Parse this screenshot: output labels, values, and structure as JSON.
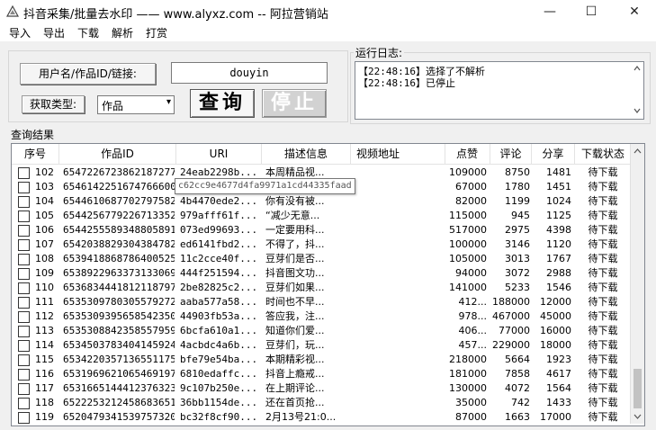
{
  "window": {
    "title": "抖音采集/批量去水印 —— www.alyxz.com -- 阿拉营销站",
    "minimize": "—",
    "maximize": "☐",
    "close": "✕"
  },
  "menu": [
    "导入",
    "导出",
    "下载",
    "解析",
    "打赏"
  ],
  "form": {
    "user_label": "用户名/作品ID/链接:",
    "user_value": "douyin",
    "type_label": "获取类型:",
    "type_value": "作品",
    "query_button": "查询",
    "stop_button": "停止"
  },
  "log": {
    "label": "运行日志:",
    "lines": [
      "【22:48:16】选择了不解析",
      "【22:48:16】已停止"
    ]
  },
  "results": {
    "label": "查询结果",
    "columns": [
      "序号",
      "作品ID",
      "URI",
      "描述信息",
      "视频地址",
      "点赞",
      "评论",
      "分享",
      "下载状态"
    ],
    "rows": [
      [
        "102",
        "6547226723862187277",
        "24eab2298b...",
        "本周精品视...",
        "",
        "109000",
        "8750",
        "1481",
        "待下载"
      ],
      [
        "103",
        "6546142251674766600",
        "",
        "",
        "",
        "67000",
        "1780",
        "1451",
        "待下载"
      ],
      [
        "104",
        "6544610687702797582",
        "4b4470ede2...",
        "你有没有被...",
        "",
        "82000",
        "1199",
        "1024",
        "待下载"
      ],
      [
        "105",
        "6544256779226713352",
        "979afff61f...",
        "“减少无意...",
        "",
        "115000",
        "945",
        "1125",
        "待下载"
      ],
      [
        "106",
        "6544255589348805891",
        "073ed99693...",
        "一定要用科...",
        "",
        "517000",
        "2975",
        "4398",
        "待下载"
      ],
      [
        "107",
        "6542038829304384782",
        "ed6141fbd2...",
        "不得了，抖...",
        "",
        "100000",
        "3146",
        "1120",
        "待下载"
      ],
      [
        "108",
        "6539418868786400525",
        "11c2cce40f...",
        "豆芽们是否...",
        "",
        "105000",
        "3013",
        "1767",
        "待下载"
      ],
      [
        "109",
        "6538922963373133069",
        "444f251594...",
        "抖音图文功...",
        "",
        "94000",
        "3072",
        "2988",
        "待下载"
      ],
      [
        "110",
        "6536834441812118797",
        "2be82825c2...",
        "豆芽们如果...",
        "",
        "141000",
        "5233",
        "1546",
        "待下载"
      ],
      [
        "111",
        "6535309780305579272",
        "aaba577a58...",
        "时间也不早...",
        "",
        "412...",
        "188000",
        "12000",
        "待下载"
      ],
      [
        "112",
        "6535309395658542350",
        "44903fb53a...",
        "答应我，注...",
        "",
        "978...",
        "467000",
        "45000",
        "待下载"
      ],
      [
        "113",
        "6535308842358557959",
        "6bcfa610a1...",
        "知道你们爱...",
        "",
        "406...",
        "77000",
        "16000",
        "待下载"
      ],
      [
        "114",
        "6534503783404145924",
        "4acbdc4a6b...",
        "豆芽们，玩...",
        "",
        "457...",
        "229000",
        "18000",
        "待下载"
      ],
      [
        "115",
        "6534220357136551175",
        "bfe79e54ba...",
        "本期精彩视...",
        "",
        "218000",
        "5664",
        "1923",
        "待下载"
      ],
      [
        "116",
        "6531969621065469197",
        "6810edaffc...",
        "抖音上瘾戒...",
        "",
        "181000",
        "7858",
        "4617",
        "待下载"
      ],
      [
        "117",
        "6531665144412376323",
        "9c107b250e...",
        "在上期评论...",
        "",
        "130000",
        "4072",
        "1564",
        "待下载"
      ],
      [
        "118",
        "6522253212458683651",
        "36bb1154de...",
        "还在首页抢...",
        "",
        "35000",
        "742",
        "1433",
        "待下载"
      ],
      [
        "119",
        "6520479341539757320",
        "bc32f8cf90...",
        "2月13号21:0...",
        "",
        "87000",
        "1663",
        "17000",
        "待下载"
      ]
    ]
  },
  "tooltip": "c62cc9e4677d4fa9971a1cd44335faad",
  "colors": {
    "accent": "#2a6fd6",
    "background": "#f0f0f0"
  }
}
